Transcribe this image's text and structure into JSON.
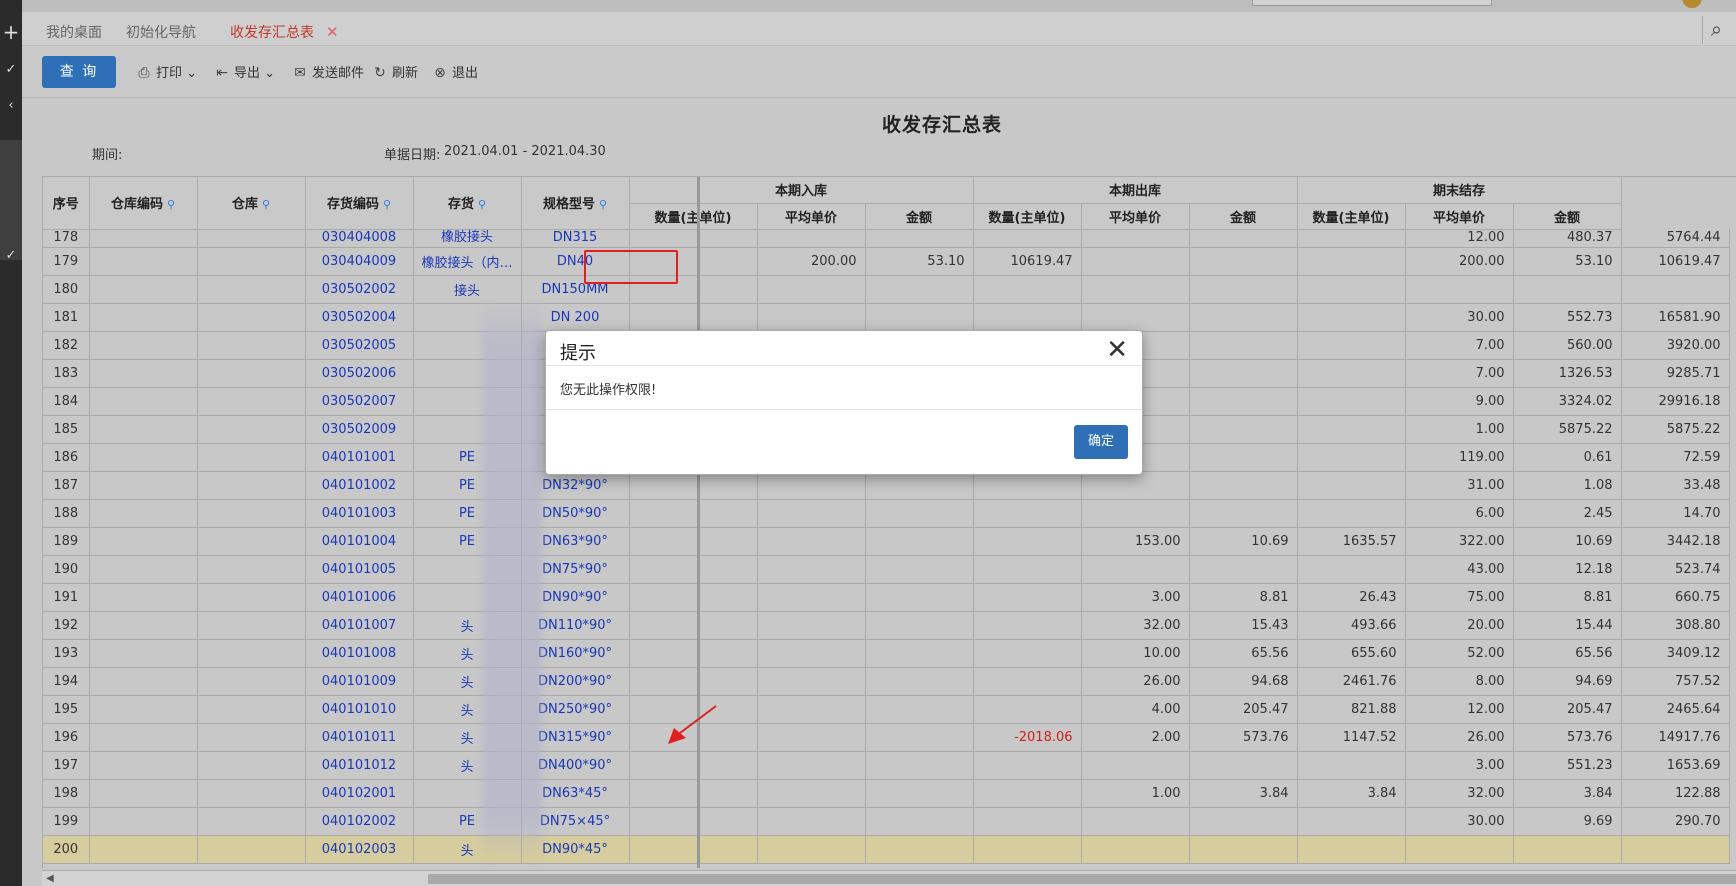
{
  "tabs": [
    {
      "label": "我的桌面",
      "active": false
    },
    {
      "label": "初始化导航",
      "active": false
    },
    {
      "label": "收发存汇总表",
      "active": true
    }
  ],
  "tab_close": "✕",
  "toolbar": {
    "query": "查 询",
    "print": "打印",
    "export": "导出",
    "send_mail": "发送邮件",
    "refresh": "刷新",
    "exit": "退出"
  },
  "report": {
    "title": "收发存汇总表",
    "period_label": "期间:",
    "date_label": "单据日期:",
    "date_value": "2021.04.01 - 2021.04.30"
  },
  "columns": {
    "seq": "序号",
    "wh_code": "仓库编码",
    "wh": "仓库",
    "inv_code": "存货编码",
    "inv": "存货",
    "spec": "规格型号",
    "group_in": "本期入库",
    "group_out": "本期出库",
    "group_end": "期末结存",
    "qty": "数量(主单位)",
    "avg_price": "平均单价",
    "amount": "金额"
  },
  "rows": [
    {
      "seq": "178",
      "code": "030404008",
      "name": "橡胶接头",
      "spec": "DN315",
      "in_qty": "",
      "in_price": "",
      "in_amt": "",
      "out_qty": "",
      "out_price": "",
      "out_amt": "",
      "end_qty": "12.00",
      "end_price": "480.37",
      "end_amt": "5764.44"
    },
    {
      "seq": "179",
      "code": "030404009",
      "name": "橡胶接头（内…",
      "spec": "DN40",
      "in_qty": "200.00",
      "in_price": "53.10",
      "in_amt": "10619.47",
      "out_qty": "",
      "out_price": "",
      "out_amt": "",
      "end_qty": "200.00",
      "end_price": "53.10",
      "end_amt": "10619.47"
    },
    {
      "seq": "180",
      "code": "030502002",
      "name": "接头",
      "spec": "DN150MM",
      "in_qty": "",
      "in_price": "",
      "in_amt": "",
      "out_qty": "",
      "out_price": "",
      "out_amt": "",
      "end_qty": "",
      "end_price": "",
      "end_amt": ""
    },
    {
      "seq": "181",
      "code": "030502004",
      "name": "",
      "spec": "DN 200",
      "in_qty": "",
      "in_price": "",
      "in_amt": "",
      "out_qty": "",
      "out_price": "",
      "out_amt": "",
      "end_qty": "30.00",
      "end_price": "552.73",
      "end_amt": "16581.90"
    },
    {
      "seq": "182",
      "code": "030502005",
      "name": "",
      "spec": "",
      "in_qty": "",
      "in_price": "",
      "in_amt": "",
      "out_qty": "",
      "out_price": "",
      "out_amt": "",
      "end_qty": "7.00",
      "end_price": "560.00",
      "end_amt": "3920.00"
    },
    {
      "seq": "183",
      "code": "030502006",
      "name": "",
      "spec": "",
      "in_qty": "",
      "in_price": "",
      "in_amt": "",
      "out_qty": "",
      "out_price": "",
      "out_amt": "",
      "end_qty": "7.00",
      "end_price": "1326.53",
      "end_amt": "9285.71"
    },
    {
      "seq": "184",
      "code": "030502007",
      "name": "",
      "spec": "",
      "in_qty": "",
      "in_price": "",
      "in_amt": "",
      "out_qty": "",
      "out_price": "",
      "out_amt": "",
      "end_qty": "9.00",
      "end_price": "3324.02",
      "end_amt": "29916.18"
    },
    {
      "seq": "185",
      "code": "030502009",
      "name": "",
      "spec": "",
      "in_qty": "",
      "in_price": "",
      "in_amt": "",
      "out_qty": "",
      "out_price": "",
      "out_amt": "",
      "end_qty": "1.00",
      "end_price": "5875.22",
      "end_amt": "5875.22"
    },
    {
      "seq": "186",
      "code": "040101001",
      "name": "PE",
      "spec": "",
      "in_qty": "",
      "in_price": "",
      "in_amt": "",
      "out_qty": "",
      "out_price": "",
      "out_amt": "",
      "end_qty": "119.00",
      "end_price": "0.61",
      "end_amt": "72.59"
    },
    {
      "seq": "187",
      "code": "040101002",
      "name": "PE",
      "spec": "DN32*90°",
      "in_qty": "",
      "in_price": "",
      "in_amt": "",
      "out_qty": "",
      "out_price": "",
      "out_amt": "",
      "end_qty": "31.00",
      "end_price": "1.08",
      "end_amt": "33.48"
    },
    {
      "seq": "188",
      "code": "040101003",
      "name": "PE",
      "spec": "DN50*90°",
      "in_qty": "",
      "in_price": "",
      "in_amt": "",
      "out_qty": "",
      "out_price": "",
      "out_amt": "",
      "end_qty": "6.00",
      "end_price": "2.45",
      "end_amt": "14.70"
    },
    {
      "seq": "189",
      "code": "040101004",
      "name": "PE",
      "spec": "DN63*90°",
      "in_qty": "",
      "in_price": "",
      "in_amt": "",
      "out_qty": "153.00",
      "out_price": "10.69",
      "out_amt": "1635.57",
      "end_qty": "322.00",
      "end_price": "10.69",
      "end_amt": "3442.18"
    },
    {
      "seq": "190",
      "code": "040101005",
      "name": "",
      "spec": "DN75*90°",
      "in_qty": "",
      "in_price": "",
      "in_amt": "",
      "out_qty": "",
      "out_price": "",
      "out_amt": "",
      "end_qty": "43.00",
      "end_price": "12.18",
      "end_amt": "523.74"
    },
    {
      "seq": "191",
      "code": "040101006",
      "name": "",
      "spec": "DN90*90°",
      "in_qty": "",
      "in_price": "",
      "in_amt": "",
      "out_qty": "3.00",
      "out_price": "8.81",
      "out_amt": "26.43",
      "end_qty": "75.00",
      "end_price": "8.81",
      "end_amt": "660.75"
    },
    {
      "seq": "192",
      "code": "040101007",
      "name": "头",
      "spec": "DN110*90°",
      "in_qty": "",
      "in_price": "",
      "in_amt": "",
      "out_qty": "32.00",
      "out_price": "15.43",
      "out_amt": "493.66",
      "end_qty": "20.00",
      "end_price": "15.44",
      "end_amt": "308.80"
    },
    {
      "seq": "193",
      "code": "040101008",
      "name": "头",
      "spec": "DN160*90°",
      "in_qty": "",
      "in_price": "",
      "in_amt": "",
      "out_qty": "10.00",
      "out_price": "65.56",
      "out_amt": "655.60",
      "end_qty": "52.00",
      "end_price": "65.56",
      "end_amt": "3409.12"
    },
    {
      "seq": "194",
      "code": "040101009",
      "name": "头",
      "spec": "DN200*90°",
      "in_qty": "",
      "in_price": "",
      "in_amt": "",
      "out_qty": "26.00",
      "out_price": "94.68",
      "out_amt": "2461.76",
      "end_qty": "8.00",
      "end_price": "94.69",
      "end_amt": "757.52"
    },
    {
      "seq": "195",
      "code": "040101010",
      "name": "头",
      "spec": "DN250*90°",
      "in_qty": "",
      "in_price": "",
      "in_amt": "",
      "out_qty": "4.00",
      "out_price": "205.47",
      "out_amt": "821.88",
      "end_qty": "12.00",
      "end_price": "205.47",
      "end_amt": "2465.64"
    },
    {
      "seq": "196",
      "code": "040101011",
      "name": "头",
      "spec": "DN315*90°",
      "in_qty": "",
      "in_price": "",
      "in_amt": "-2018.06",
      "out_qty": "2.00",
      "out_price": "573.76",
      "out_amt": "1147.52",
      "end_qty": "26.00",
      "end_price": "573.76",
      "end_amt": "14917.76"
    },
    {
      "seq": "197",
      "code": "040101012",
      "name": "头",
      "spec": "DN400*90°",
      "in_qty": "",
      "in_price": "",
      "in_amt": "",
      "out_qty": "",
      "out_price": "",
      "out_amt": "",
      "end_qty": "3.00",
      "end_price": "551.23",
      "end_amt": "1653.69"
    },
    {
      "seq": "198",
      "code": "040102001",
      "name": "",
      "spec": "DN63*45°",
      "in_qty": "",
      "in_price": "",
      "in_amt": "",
      "out_qty": "1.00",
      "out_price": "3.84",
      "out_amt": "3.84",
      "end_qty": "32.00",
      "end_price": "3.84",
      "end_amt": "122.88"
    },
    {
      "seq": "199",
      "code": "040102002",
      "name": "PE",
      "spec": "DN75×45°",
      "in_qty": "",
      "in_price": "",
      "in_amt": "",
      "out_qty": "",
      "out_price": "",
      "out_amt": "",
      "end_qty": "30.00",
      "end_price": "9.69",
      "end_amt": "290.70"
    },
    {
      "seq": "200",
      "code": "040102003",
      "name": "头",
      "spec": "DN90*45°",
      "in_qty": "",
      "in_price": "",
      "in_amt": "",
      "out_qty": "",
      "out_price": "",
      "out_amt": "",
      "end_qty": "",
      "end_price": "",
      "end_amt": ""
    }
  ],
  "dialog": {
    "title": "提示",
    "message": "您无此操作权限!",
    "ok": "确定",
    "close": "✕"
  }
}
